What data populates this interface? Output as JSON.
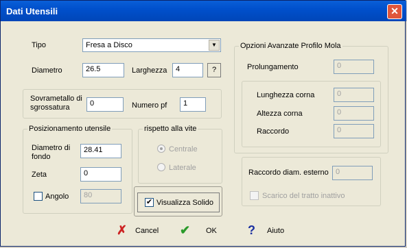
{
  "window": {
    "title": "Dati Utensili",
    "close_glyph": "✕"
  },
  "tipo": {
    "label": "Tipo",
    "value": "Fresa a Disco"
  },
  "diametro": {
    "label": "Diametro",
    "value": "26.5"
  },
  "larghezza": {
    "label": "Larghezza",
    "value": "4",
    "help_label": "?"
  },
  "sovrametallo": {
    "label_line1": "Sovrametallo di",
    "label_line2": "sgrossatura",
    "value": "0"
  },
  "numero_pf": {
    "label": "Numero pf",
    "value": "1"
  },
  "posizionamento": {
    "legend": "Posizionamento utensile",
    "diam_fondo_line1": "Diametro di",
    "diam_fondo_line2": "fondo",
    "diam_fondo_value": "28.41",
    "zeta_label": "Zeta",
    "zeta_value": "0",
    "angolo_label": "Angolo",
    "angolo_value": "80"
  },
  "rispetto": {
    "legend": "rispetto alla vite",
    "centrale": "Centrale",
    "laterale": "Laterale"
  },
  "visualizza": {
    "label": "Visualizza Solido",
    "checked": true
  },
  "opzioni": {
    "legend": "Opzioni Avanzate Profilo Mola",
    "prolungamento_label": "Prolungamento",
    "prolungamento_value": "0",
    "lunghezza_label": "Lunghezza corna",
    "lunghezza_value": "0",
    "altezza_label": "Altezza corna",
    "altezza_value": "0",
    "raccordo_label": "Raccordo",
    "raccordo_value": "0",
    "raccordo_diam_label": "Raccordo diam. esterno",
    "raccordo_diam_value": "0",
    "scarico_label": "Scarico del tratto inattivo"
  },
  "footer": {
    "cancel": "Cancel",
    "ok": "OK",
    "help": "Aiuto"
  },
  "colors": {
    "cancel_icon": "#cc2222",
    "ok_icon": "#2a9a2a",
    "help_icon": "#1a2fa0"
  }
}
